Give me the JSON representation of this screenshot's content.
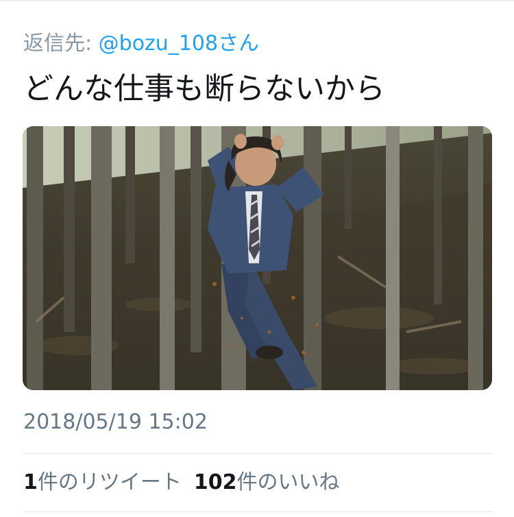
{
  "reply": {
    "prefix": "返信先: ",
    "handle": "@bozu_108さん"
  },
  "tweet": {
    "text": "どんな仕事も断らないから",
    "timestamp": "2018/05/19 15:02"
  },
  "stats": {
    "retweet_count": "1",
    "retweet_label": "件のリツイート",
    "like_count": "102",
    "like_label": "件のいいね"
  },
  "colors": {
    "accent": "#1da1f2",
    "muted": "#657786",
    "text": "#14171a",
    "divider": "#e1e8ed"
  }
}
